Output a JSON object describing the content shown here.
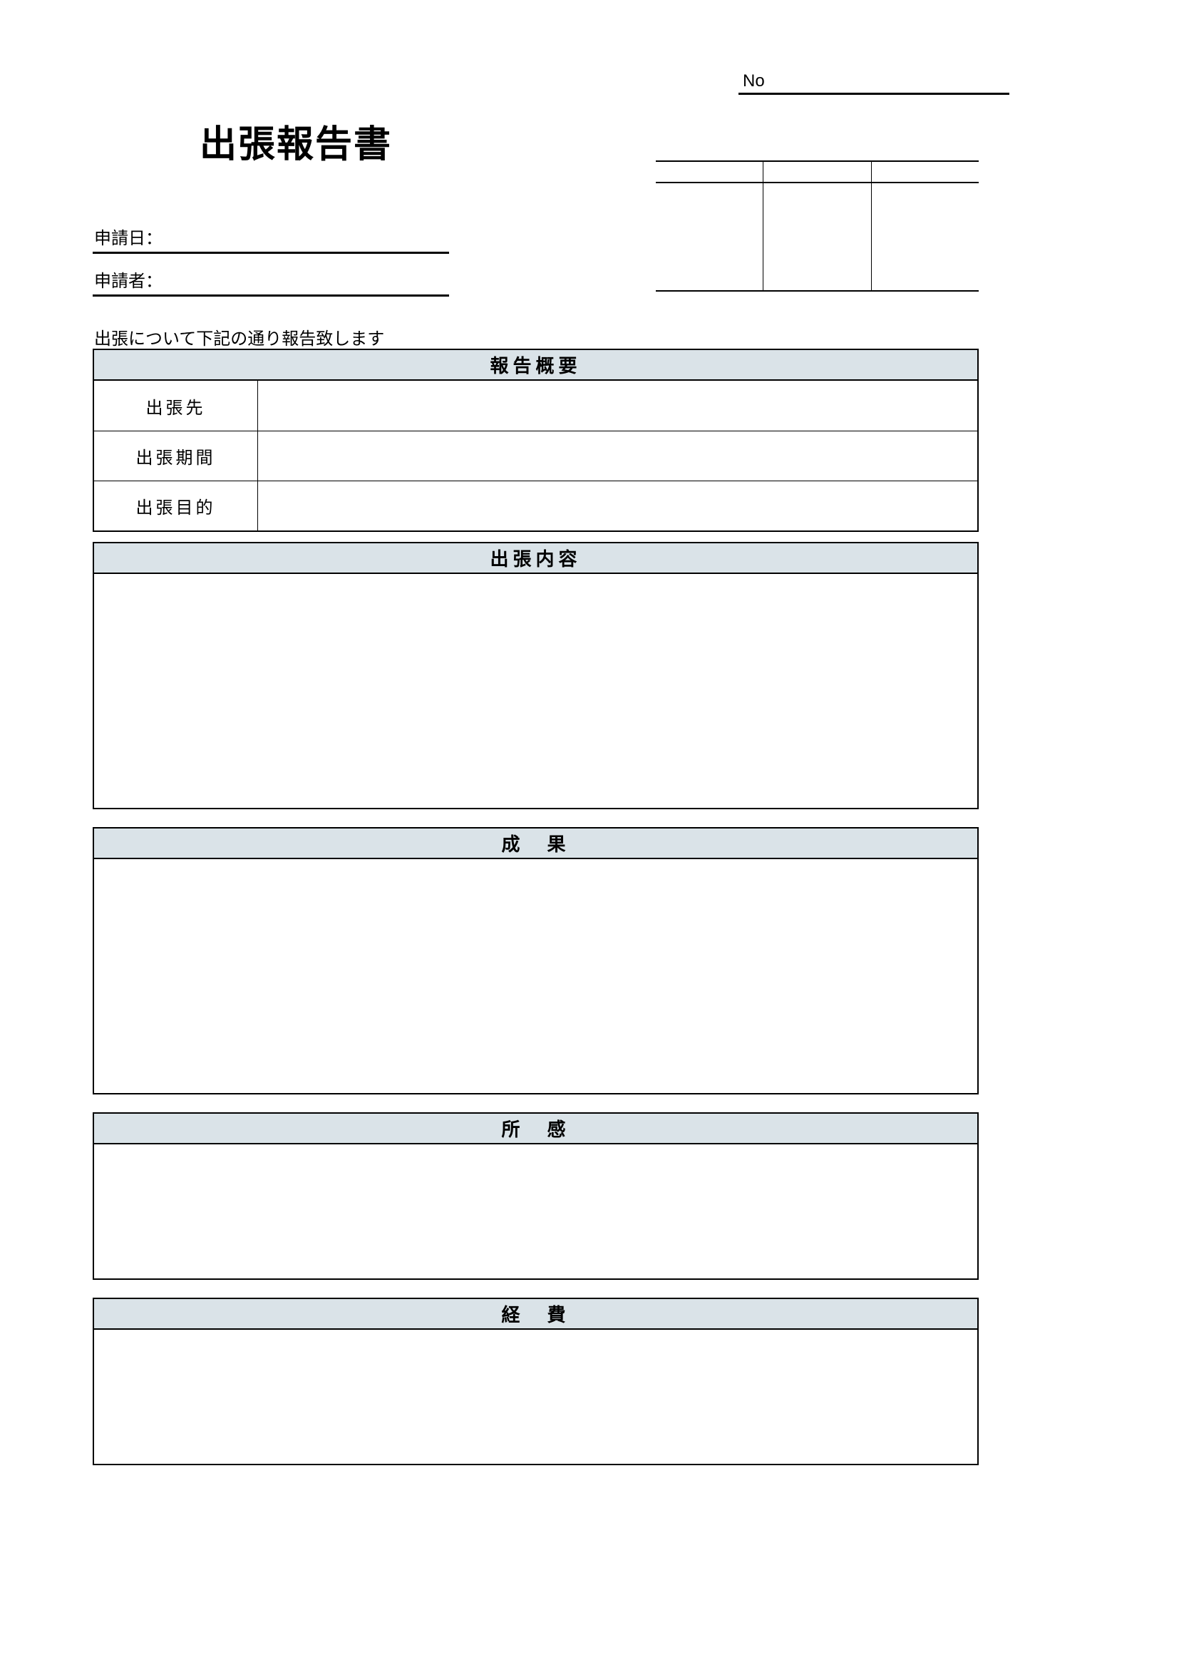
{
  "no_label": "No",
  "title": "出張報告書",
  "applicant": {
    "date_label": "申請日：",
    "name_label": "申請者："
  },
  "intro_text": "出張について下記の通り報告致します",
  "sections": {
    "summary_header": "報告概要",
    "destination_label": "出張先",
    "period_label": "出張期間",
    "purpose_label": "出張目的",
    "content_header": "出張内容",
    "result_header": "成　果",
    "thoughts_header": "所　感",
    "expense_header": "経　費"
  }
}
